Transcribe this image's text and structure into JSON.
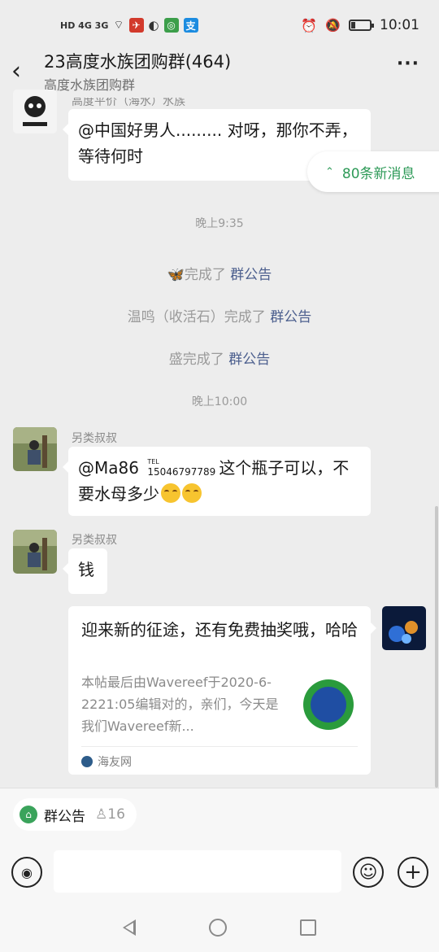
{
  "status_bar": {
    "network": "HD 4G 3G",
    "time": "10:01",
    "battery_level": 0.2
  },
  "header": {
    "title": "23高度水族团购群(464)",
    "subtitle": "高度水族团购群",
    "more": "···"
  },
  "new_messages": "80条新消息",
  "messages": {
    "m1": {
      "sender": "高度平价（海水）水族",
      "text": "@中国好男人......... 对呀，那你不弄，等待何时"
    },
    "time1": "晚上9:35",
    "system": [
      {
        "prefix": "",
        "action": "完成了 ",
        "link": "群公告"
      },
      {
        "prefix": "温鸣（收活石）",
        "action": "完成了 ",
        "link": "群公告"
      },
      {
        "prefix": "盛",
        "action": "完成了 ",
        "link": "群公告"
      }
    ],
    "time2": "晚上10:00",
    "m2": {
      "sender": "另类叔叔",
      "mention": "@Ma86",
      "tel_label": "TEL",
      "phone": "15046797789",
      "text": "这个瓶子可以，不要水母多少"
    },
    "m3": {
      "sender": "另类叔叔",
      "text": "钱"
    },
    "card": {
      "title": "迎来新的征途，还有免费抽奖哦，哈哈",
      "desc": "本帖最后由Wavereef于2020-6-2221:05编辑对的，亲们，今天是我们Wavereef新...",
      "source": "海友网"
    }
  },
  "bottom": {
    "notice_label": "群公告",
    "people_count": "16"
  }
}
